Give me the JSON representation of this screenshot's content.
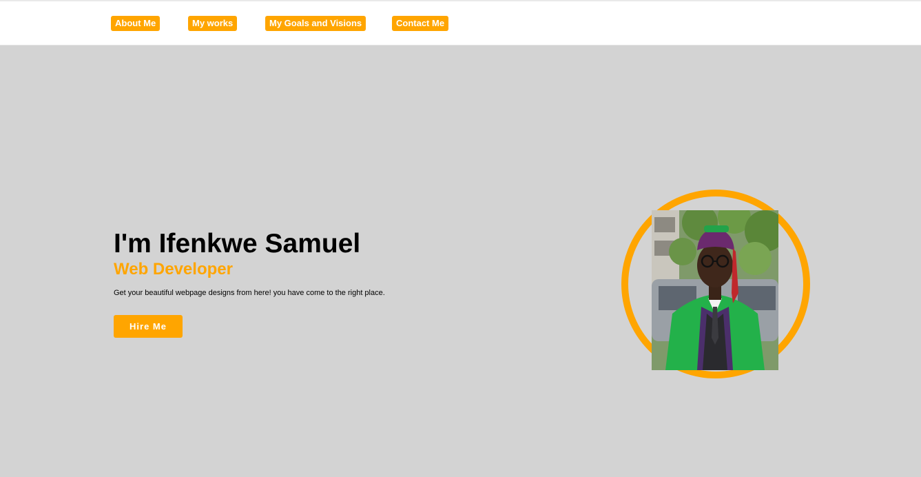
{
  "nav": {
    "items": [
      {
        "label": "About Me"
      },
      {
        "label": "My works"
      },
      {
        "label": "My Goals and Visions"
      },
      {
        "label": "Contact Me"
      }
    ]
  },
  "hero": {
    "title": "I'm Ifenkwe Samuel",
    "role": "Web Developer",
    "description": "Get your beautiful webpage designs from here! you have come to the right place.",
    "cta_label": "Hire Me"
  },
  "theme": {
    "accent": "#ffa500",
    "background": "#d3d3d3",
    "navbar_background": "#ffffff"
  }
}
